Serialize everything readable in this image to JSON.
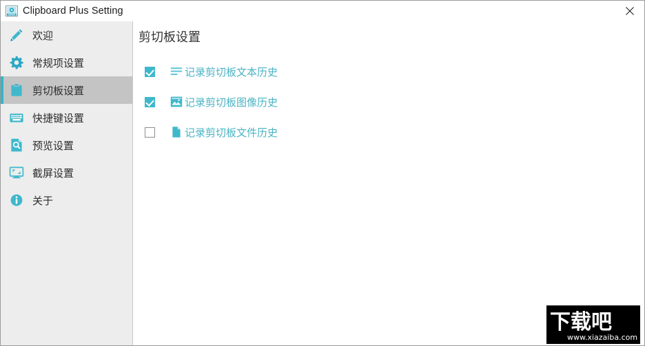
{
  "window": {
    "title": "Clipboard Plus Setting",
    "app_icon": "clipboard-app-icon",
    "close_label": "✕"
  },
  "sidebar": {
    "items": [
      {
        "id": "welcome",
        "label": "欢迎",
        "icon": "pencil-icon",
        "active": false
      },
      {
        "id": "general",
        "label": "常规项设置",
        "icon": "gear-icon",
        "active": false
      },
      {
        "id": "clipboard",
        "label": "剪切板设置",
        "icon": "clipboard-icon",
        "active": true
      },
      {
        "id": "hotkey",
        "label": "快捷键设置",
        "icon": "keyboard-icon",
        "active": false
      },
      {
        "id": "preview",
        "label": "预览设置",
        "icon": "preview-icon",
        "active": false
      },
      {
        "id": "capture",
        "label": "截屏设置",
        "icon": "monitor-icon",
        "active": false
      },
      {
        "id": "about",
        "label": "关于",
        "icon": "info-icon",
        "active": false
      }
    ]
  },
  "main": {
    "title": "剪切板设置",
    "options": [
      {
        "id": "text-history",
        "label": "记录剪切板文本历史",
        "icon": "text-lines-icon",
        "checked": true
      },
      {
        "id": "image-history",
        "label": "记录剪切板图像历史",
        "icon": "image-icon",
        "checked": true
      },
      {
        "id": "file-history",
        "label": "记录剪切板文件历史",
        "icon": "file-icon",
        "checked": false
      }
    ]
  },
  "watermark": {
    "logo_text": "下载吧",
    "url_text": "www.xiazaiba.com"
  },
  "colors": {
    "accent": "#3fb8cc",
    "accent_dark": "#35b4c8",
    "label_blue": "#4ab3c4",
    "sidebar_bg": "#ededed",
    "sidebar_active_bg": "#c4c4c4",
    "text": "#2d2d2d"
  }
}
